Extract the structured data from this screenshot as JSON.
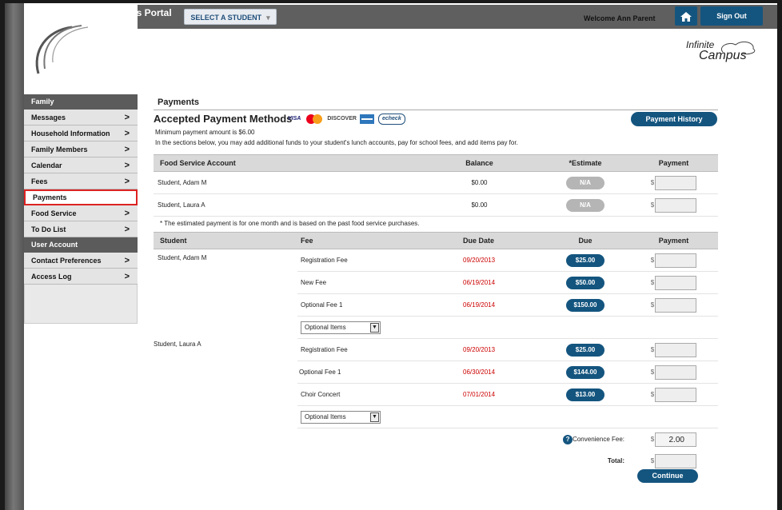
{
  "header": {
    "portal_title": "Campus Portal",
    "select_student_label": "SELECT A STUDENT",
    "welcome_text": "Welcome Ann Parent",
    "home_icon": "home-icon",
    "sign_out_label": "Sign Out",
    "logo_line1": "Infinite",
    "logo_line2": "Campus"
  },
  "sidebar": {
    "family_heading": "Family",
    "family_items": [
      {
        "label": "Messages",
        "chevron": true
      },
      {
        "label": "Household Information",
        "chevron": true
      },
      {
        "label": "Family Members",
        "chevron": true
      },
      {
        "label": "Calendar",
        "chevron": true
      },
      {
        "label": "Fees",
        "chevron": true
      },
      {
        "label": "Payments",
        "chevron": false,
        "active": true
      },
      {
        "label": "Food Service",
        "chevron": true
      },
      {
        "label": "To Do List",
        "chevron": true
      }
    ],
    "user_heading": "User Account",
    "user_items": [
      {
        "label": "Contact Preferences",
        "chevron": true
      },
      {
        "label": "Access Log",
        "chevron": true
      }
    ],
    "chevron_glyph": ">"
  },
  "main": {
    "page_title": "Payments",
    "accepted_title": "Accepted Payment Methods",
    "cards": [
      "VISA",
      "MasterCard",
      "DISCOVER",
      "AMEX",
      "echeck"
    ],
    "payment_history_label": "Payment History",
    "min_payment_text": "Minimum payment amount is $6.00",
    "intro_text": "In the sections below, you may add additional funds to your student's lunch accounts, pay for school fees, and add items pay for.",
    "food_service": {
      "headers": [
        "Food Service Account",
        "Balance",
        "*Estimate",
        "Payment"
      ],
      "rows": [
        {
          "student": "Student, Adam M",
          "balance": "$0.00",
          "estimate": "N/A"
        },
        {
          "student": "Student, Laura A",
          "balance": "$0.00",
          "estimate": "N/A"
        }
      ],
      "note": "* The estimated payment is for one month and is based on the past food service purchases."
    },
    "fees": {
      "headers": [
        "Student",
        "Fee",
        "Due Date",
        "Due",
        "Payment"
      ],
      "groups": [
        {
          "student": "Student, Adam M",
          "items": [
            {
              "fee": "Registration Fee",
              "due_date": "09/20/2013",
              "due": "$25.00"
            },
            {
              "fee": "New Fee",
              "due_date": "06/19/2014",
              "due": "$50.00"
            },
            {
              "fee": "Optional Fee 1",
              "due_date": "06/19/2014",
              "due": "$150.00"
            }
          ],
          "optional_label": "Optional Items"
        },
        {
          "student": "Student, Laura A",
          "items": [
            {
              "fee": "Registration Fee",
              "due_date": "09/20/2013",
              "due": "$25.00"
            },
            {
              "fee": "Optional Fee 1",
              "due_date": "06/30/2014",
              "due": "$144.00"
            },
            {
              "fee": "Choir Concert",
              "due_date": "07/01/2014",
              "due": "$13.00"
            }
          ],
          "optional_label": "Optional Items"
        }
      ]
    },
    "currency_symbol": "$",
    "convenience_fee_label": "Convenience Fee:",
    "convenience_fee_value": "2.00",
    "total_label": "Total:",
    "continue_label": "Continue",
    "help_glyph": "?"
  },
  "colors": {
    "accent": "#14557f",
    "due_date_red": "#cc0000",
    "highlight_border": "#dd2222"
  }
}
